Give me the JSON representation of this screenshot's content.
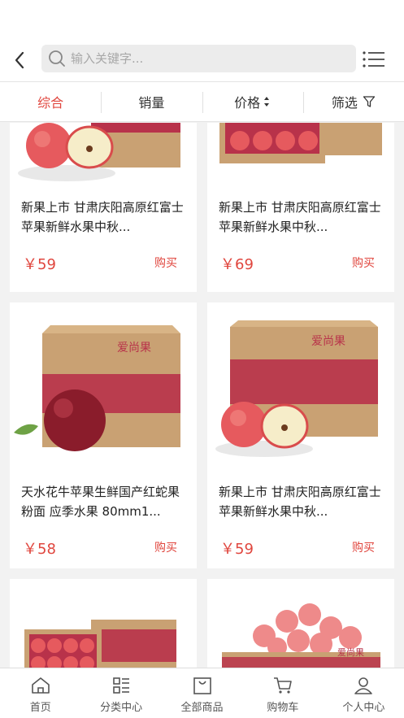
{
  "search": {
    "placeholder": "输入关键字..."
  },
  "sort_tabs": [
    {
      "label": "综合"
    },
    {
      "label": "销量"
    },
    {
      "label": "价格"
    },
    {
      "label": "筛选"
    }
  ],
  "products": [
    {
      "title": "新果上市 甘肃庆阳高原红富士 苹果新鲜水果中秋...",
      "price": "￥59",
      "buy": "购买"
    },
    {
      "title": "新果上市 甘肃庆阳高原红富士 苹果新鲜水果中秋...",
      "price": "￥69",
      "buy": "购买"
    },
    {
      "title": "天水花牛苹果生鲜国产红蛇果粉面 应季水果 80mm1...",
      "price": "￥58",
      "buy": "购买"
    },
    {
      "title": "新果上市 甘肃庆阳高原红富士 苹果新鲜水果中秋...",
      "price": "￥59",
      "buy": "购买"
    },
    {
      "title": "",
      "price": "",
      "buy": ""
    },
    {
      "title": "",
      "price": "",
      "buy": ""
    }
  ],
  "brand_logo_text": "爱尚果",
  "tabbar": [
    {
      "label": "首页",
      "icon": "home-icon"
    },
    {
      "label": "分类中心",
      "icon": "category-icon"
    },
    {
      "label": "全部商品",
      "icon": "bag-icon"
    },
    {
      "label": "购物车",
      "icon": "cart-icon"
    },
    {
      "label": "个人中心",
      "icon": "user-icon"
    }
  ],
  "colors": {
    "accent": "#e0463e",
    "background": "#f2f2f2"
  }
}
